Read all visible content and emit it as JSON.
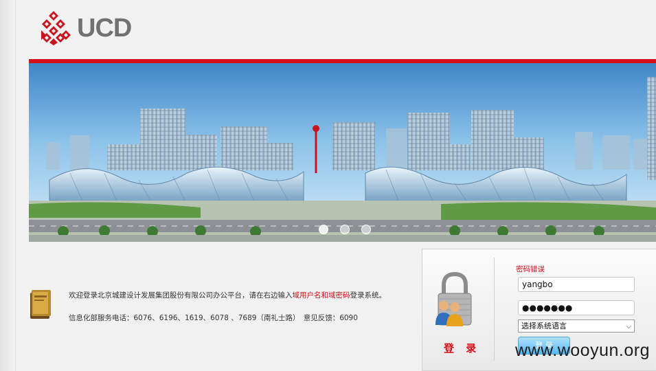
{
  "logo": {
    "text": "UCD"
  },
  "banner": {
    "slides": [
      1,
      2,
      3
    ],
    "active_slide": 1
  },
  "info": {
    "welcome_before": "欢迎登录北京城建设计发展集团股份有限公司办公平台，请在右边输入",
    "welcome_highlight": "域用户名和域密码",
    "welcome_after": "登录系统。",
    "service_line": "信息化部服务电话：6076、6196、1619、6078 、7689（南礼士路）　意见反馈：6090"
  },
  "login": {
    "title": "登 录",
    "error": "密码错误",
    "username_value": "yangbo",
    "password_value": "●●●●●●●",
    "language_select": "选择系统语言",
    "submit_label": "登 录"
  },
  "watermark": "www.wooyun.org",
  "colors": {
    "brand_red": "#d60e18",
    "button_blue": "#5ab8f0"
  }
}
